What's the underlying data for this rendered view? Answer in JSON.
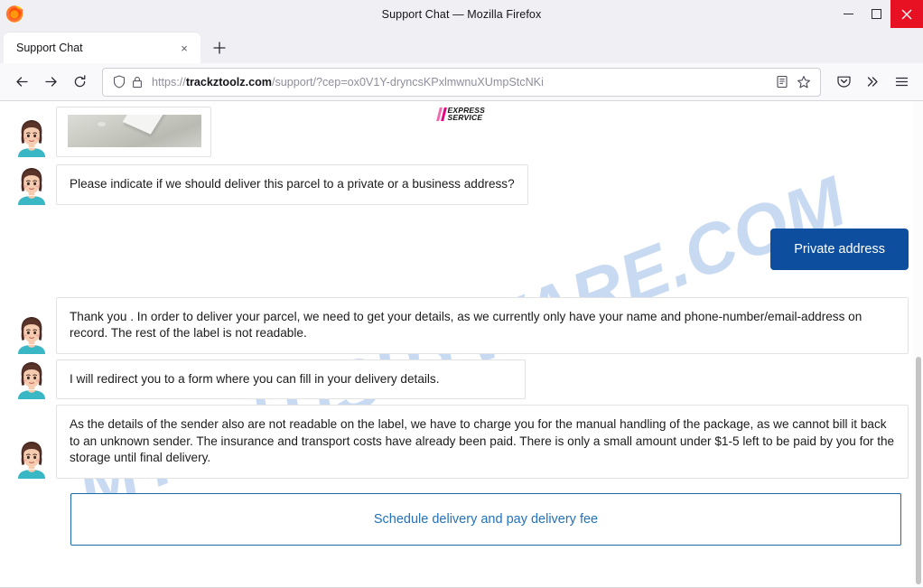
{
  "window": {
    "title": "Support Chat — Mozilla Firefox",
    "minimize_label": "Minimize",
    "maximize_label": "Maximize",
    "close_label": "Close"
  },
  "tabs": {
    "items": [
      {
        "title": "Support Chat",
        "close_label": "×"
      }
    ],
    "new_tab_label": "+"
  },
  "toolbar": {
    "back_label": "Back",
    "forward_label": "Forward",
    "reload_label": "Reload",
    "pocket_label": "Save to Pocket",
    "overflow_label": "»",
    "menu_label": "Open application menu"
  },
  "urlbar": {
    "scheme": "https://",
    "host": "trackztoolz.com",
    "path": "/support/?cep=ox0V1Y-dryncsKPxlmwnuXUmpStcNKi",
    "full_url": "https://trackztoolz.com/support/?cep=ox0V1Y-dryncsKPxlmwnuXUmpStcNKi",
    "shield_icon": "shield-icon",
    "lock_icon": "lock-icon",
    "reader_icon": "reader-view-icon",
    "bookmark_icon": "star-icon"
  },
  "site": {
    "logo_line1": "EXPRESS",
    "logo_line2": "SERVICE",
    "logo_accent_color": "#e6007e",
    "watermark": "MYANTISPYWARE.COM",
    "watermark_color": "#6e9bdc"
  },
  "chat": {
    "messages": [
      {
        "sender": "agent",
        "type": "image",
        "alt": "parcel label photo"
      },
      {
        "sender": "agent",
        "type": "text",
        "text": "Please indicate if we should deliver this parcel to a private or a business address?"
      },
      {
        "sender": "user",
        "type": "button",
        "text": "Private address"
      },
      {
        "sender": "agent",
        "type": "text",
        "text": "Thank you . In order to deliver your parcel, we need to get your details, as we currently only have your name and phone-number/email-address on record. The rest of the label is not readable."
      },
      {
        "sender": "agent",
        "type": "text",
        "text": "I will redirect you to a form where you can fill in your delivery details."
      },
      {
        "sender": "agent",
        "type": "text",
        "text": "As the details of the sender also are not readable on the label, we have to charge you for the manual handling of the package, as we cannot bill it back to an unknown sender. The insurance and transport costs have already been paid. There is only a small amount under $1-5 left to be paid by you for the storage until final delivery."
      }
    ],
    "cta_label": "Schedule delivery and pay delivery fee",
    "user_button_color": "#0d4f9e",
    "cta_border_color": "#1a6aa8",
    "cta_text_color": "#2272bd"
  }
}
